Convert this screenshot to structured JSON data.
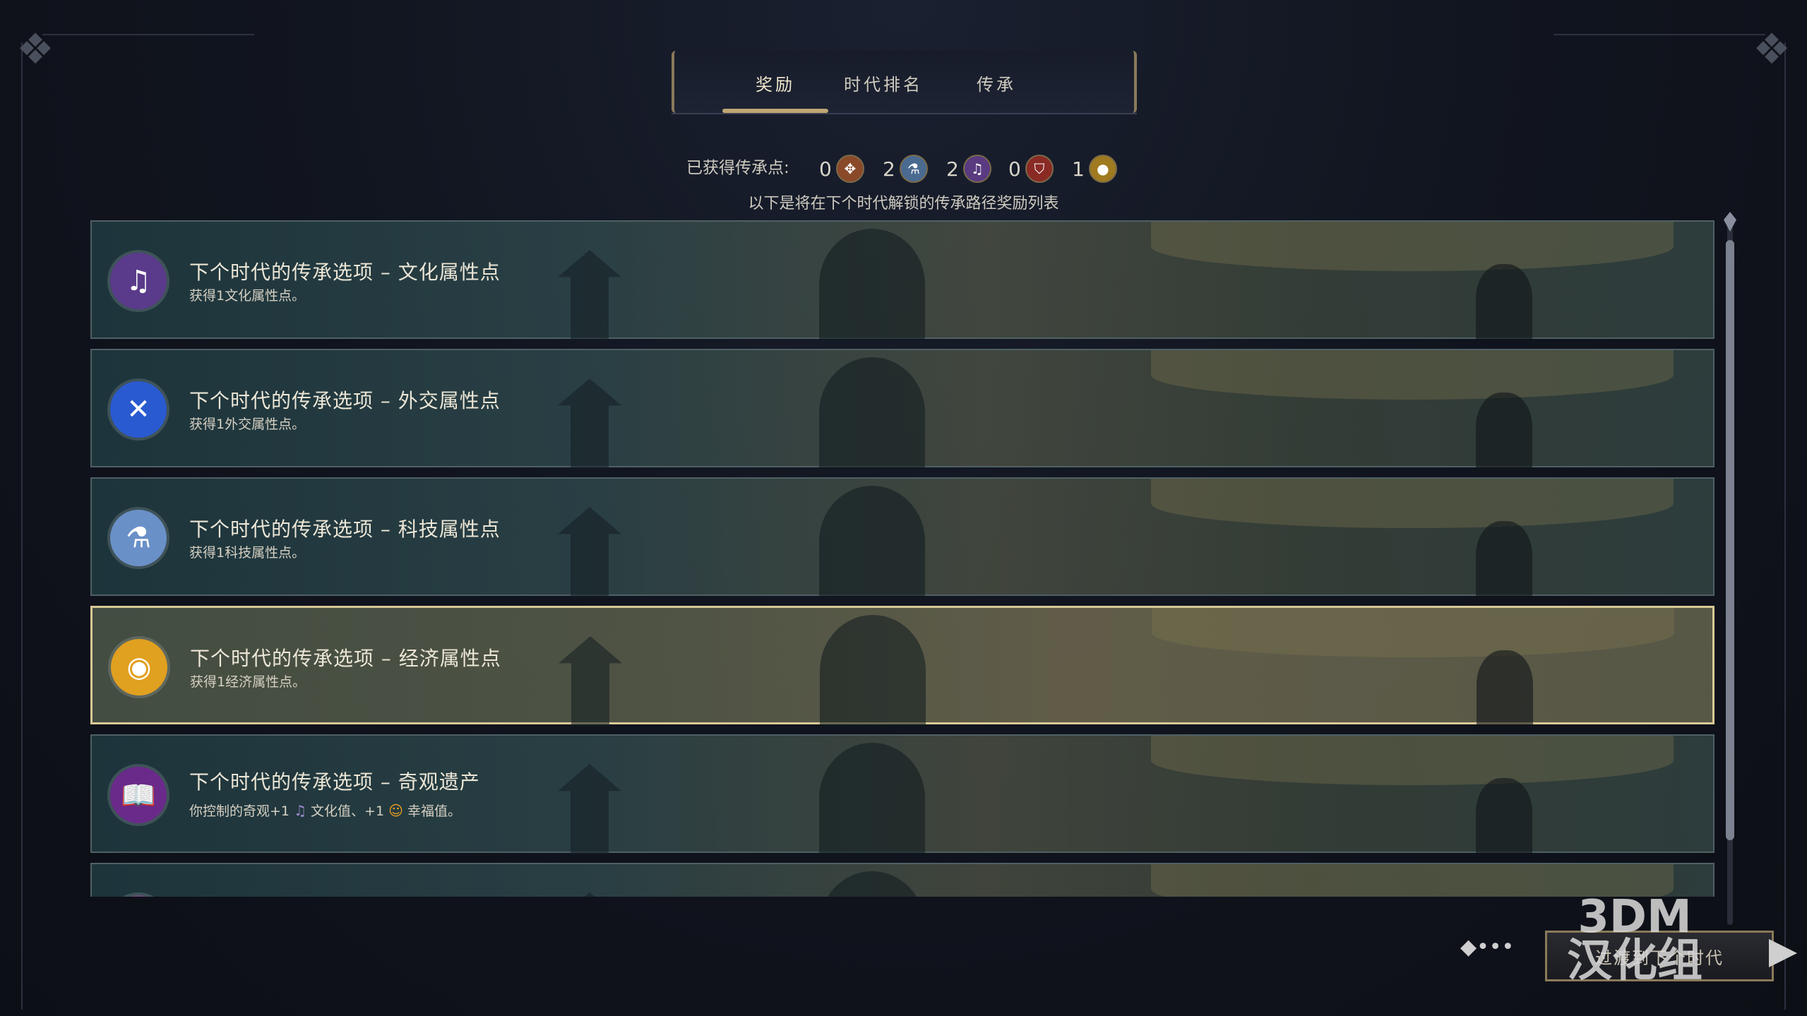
{
  "tabs": [
    {
      "label": "奖励",
      "active": true
    },
    {
      "label": "时代排名",
      "active": false
    },
    {
      "label": "传承",
      "active": false
    }
  ],
  "points": {
    "label": "已获得传承点:",
    "items": [
      {
        "value": "0",
        "icon": "military-icon",
        "color": "#b06a3a"
      },
      {
        "value": "2",
        "icon": "science-icon",
        "color": "#6a8ab0"
      },
      {
        "value": "2",
        "icon": "culture-icon",
        "color": "#7a5aa0"
      },
      {
        "value": "0",
        "icon": "military-shield-icon",
        "color": "#a03a30"
      },
      {
        "value": "1",
        "icon": "economic-icon",
        "color": "#c09a30"
      }
    ]
  },
  "subtitle": "以下是将在下个时代解锁的传承路径奖励列表",
  "rewards": [
    {
      "title": "下个时代的传承选项 – 文化属性点",
      "desc": "获得1文化属性点。",
      "icon": "culture-icon",
      "color": "#5a3a8a"
    },
    {
      "title": "下个时代的传承选项 – 外交属性点",
      "desc": "获得1外交属性点。",
      "icon": "diplomacy-icon",
      "color": "#2a5ad0"
    },
    {
      "title": "下个时代的传承选项 – 科技属性点",
      "desc": "获得1科技属性点。",
      "icon": "science-icon",
      "color": "#6a90c8"
    },
    {
      "title": "下个时代的传承选项 – 经济属性点",
      "desc": "获得1经济属性点。",
      "icon": "economic-icon",
      "color": "#e0a020"
    },
    {
      "title": "下个时代的传承选项 – 奇观遗产",
      "desc_parts": [
        "你控制的奇观+1",
        "文化值、+1",
        "幸福值。"
      ],
      "icon": "wonder-book-icon",
      "color": "#6a2a8a"
    }
  ],
  "next_button": "过渡到下个时代",
  "watermark": "3DM\n汉化组"
}
